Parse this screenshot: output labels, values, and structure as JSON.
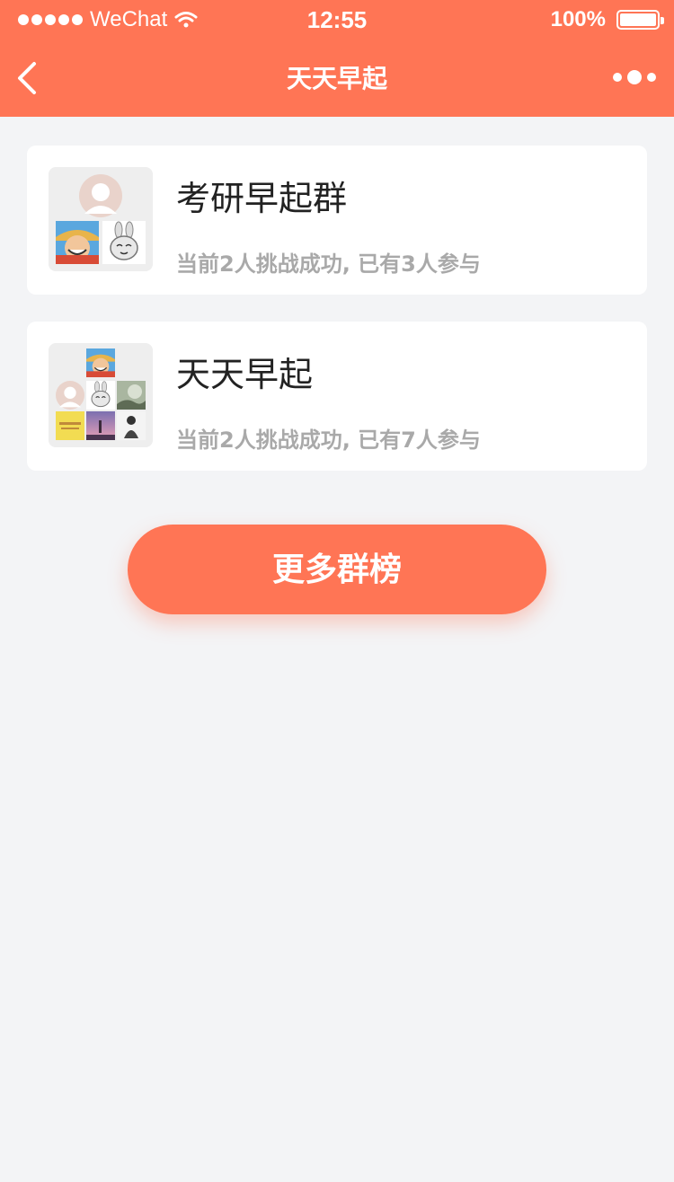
{
  "status_bar": {
    "carrier": "WeChat",
    "time": "12:55",
    "battery": "100%"
  },
  "nav": {
    "title": "天天早起"
  },
  "groups": [
    {
      "name": "考研早起群",
      "status": "当前2人挑战成功, 已有3人参与"
    },
    {
      "name": "天天早起",
      "status": "当前2人挑战成功, 已有7人参与"
    }
  ],
  "more_button": "更多群榜",
  "colors": {
    "brand": "#ff7555",
    "background": "#f3f4f6",
    "subtext": "#a9a9a9"
  }
}
